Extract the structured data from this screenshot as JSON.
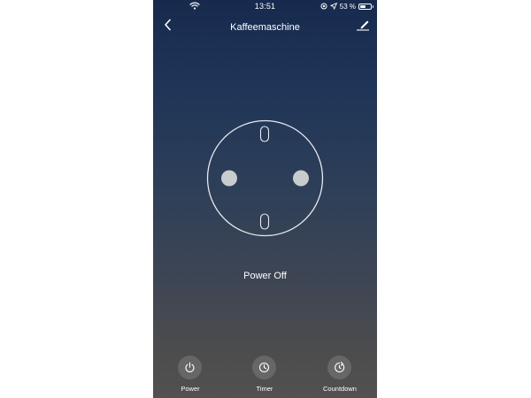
{
  "status_bar": {
    "time": "13:51",
    "battery_text": "53 %",
    "battery_level": 0.53,
    "icons": [
      "wifi-icon",
      "location-lock-icon",
      "navigation-arrow-icon",
      "battery-icon"
    ]
  },
  "nav": {
    "title": "Kaffeemaschine",
    "back_icon": "chevron-left-icon",
    "edit_icon": "pencil-edit-icon"
  },
  "device": {
    "icon": "power-socket-icon",
    "status": "Power Off"
  },
  "actions": [
    {
      "label": "Power",
      "icon": "power-icon"
    },
    {
      "label": "Timer",
      "icon": "clock-icon"
    },
    {
      "label": "Countdown",
      "icon": "countdown-icon"
    }
  ],
  "colors": {
    "background_top": "#172a4e",
    "background_bottom": "#525050",
    "socket_stroke": "#e6e9ef",
    "socket_pin": "#c9cccf",
    "text": "#ffffff"
  }
}
